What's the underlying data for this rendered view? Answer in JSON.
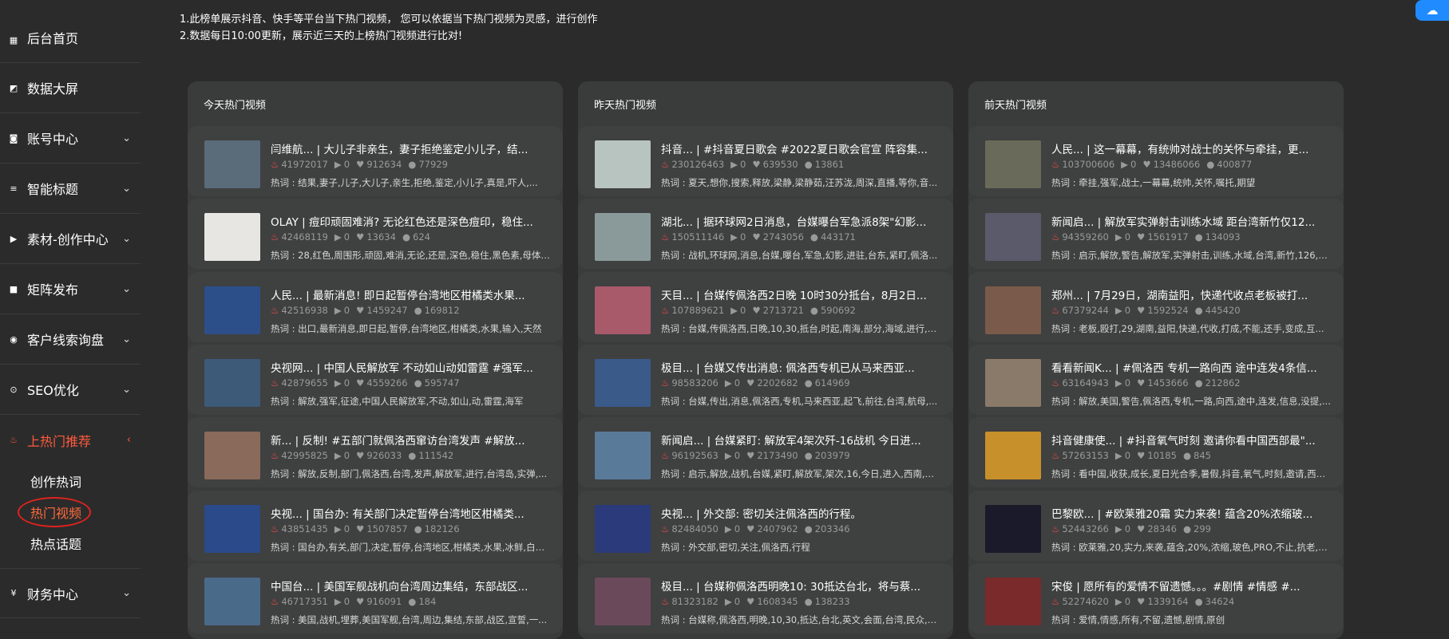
{
  "sidebar": {
    "items": [
      {
        "label": "后台首页",
        "icon": "dashboard-icon",
        "glyph": "▦",
        "chevron": ""
      },
      {
        "label": "数据大屏",
        "icon": "chart-screen-icon",
        "glyph": "◩",
        "chevron": ""
      },
      {
        "label": "账号中心",
        "icon": "account-icon",
        "glyph": "◙",
        "chevron": "⌄"
      },
      {
        "label": "智能标题",
        "icon": "title-icon",
        "glyph": "≡",
        "chevron": "⌄"
      },
      {
        "label": "素材-创作中心",
        "icon": "material-icon",
        "glyph": "▶",
        "chevron": "⌄"
      },
      {
        "label": "矩阵发布",
        "icon": "video-camera-icon",
        "glyph": "■",
        "chevron": "⌄"
      },
      {
        "label": "客户线索询盘",
        "icon": "customer-icon",
        "glyph": "◉",
        "chevron": "⌄"
      },
      {
        "label": "SEO优化",
        "icon": "seo-icon",
        "glyph": "⊙",
        "chevron": "⌄"
      },
      {
        "label": "上热门推荐",
        "icon": "fire-icon",
        "glyph": "♨",
        "chevron": "‹"
      }
    ],
    "sub_items": [
      {
        "label": "创作热词"
      },
      {
        "label": "热门视频"
      },
      {
        "label": "热点话题"
      }
    ],
    "finance": {
      "label": "财务中心",
      "icon": "finance-icon",
      "glyph": "¥",
      "chevron": "⌄"
    }
  },
  "notes": {
    "line1": "1.此榜单展示抖音、快手等平台当下热门视频， 您可以依据当下热门视频为灵感，进行创作",
    "line2": "2.数据每日10:00更新，展示近三天的上榜热门视频进行比对!"
  },
  "panels": [
    {
      "title": "今天热门视频",
      "cards": [
        {
          "title": "闫维航...   | 大儿子非亲生，妻子拒绝鉴定小儿子，结...",
          "hot": "41972017",
          "plays": "0",
          "likes": "912634",
          "comments": "77929",
          "keywords": "热词 : 结果,妻子,儿子,大儿子,亲生,拒绝,鉴定,小儿子,真是,吓人,...",
          "thumb_color": "#5a6b7a"
        },
        {
          "title": "OLAY | 痘印顽固难消? 无论红色还是深色痘印，稳住...",
          "hot": "42468119",
          "plays": "0",
          "likes": "13634",
          "comments": "624",
          "keywords": "热词 : 28,红色,周围形,顽固,难消,无论,还是,深色,稳住,黑色素,母体,...",
          "thumb_color": "#e8e6e2"
        },
        {
          "title": "人民...   | 最新消息! 即日起暂停台湾地区柑橘类水果...",
          "hot": "42516938",
          "plays": "0",
          "likes": "1459247",
          "comments": "169812",
          "keywords": "热词 : 出口,最新消息,即日起,暂停,台湾地区,柑橘类,水果,输入,天然",
          "thumb_color": "#2c4f8a"
        },
        {
          "title": "央视网...   | 中国人民解放军 不动如山动如雷霆 #强军...",
          "hot": "42879655",
          "plays": "0",
          "likes": "4559266",
          "comments": "595747",
          "keywords": "热词 : 解放,强军,征途,中国人民解放军,不动,如山,动,雷霆,海军",
          "thumb_color": "#3d5a78"
        },
        {
          "title": "新...   | 反制! #五部门就佩洛西窜访台湾发声 #解放...",
          "hot": "42995825",
          "plays": "0",
          "likes": "926033",
          "comments": "111542",
          "keywords": "热词 : 解放,反制,部门,佩洛西,台湾,发声,解放军,进行,台湾岛,实弹,...",
          "thumb_color": "#8a6a5a"
        },
        {
          "title": "央视...   | 国台办: 有关部门决定暂停台湾地区柑橘类...",
          "hot": "43851435",
          "plays": "0",
          "likes": "1507857",
          "comments": "182126",
          "keywords": "热词 : 国台办,有关,部门,决定,暂停,台湾地区,柑橘类,水果,冰鲜,白带...",
          "thumb_color": "#2a4a8a"
        },
        {
          "title": "中国台...   | 美国军舰战机向台湾周边集结，东部战区...",
          "hot": "46717351",
          "plays": "0",
          "likes": "916091",
          "comments": "184",
          "keywords": "热词 : 美国,战机,埋葬,美国军舰,台湾,周边,集结,东部,战区,宣誓,一...",
          "thumb_color": "#4a6a8a"
        }
      ]
    },
    {
      "title": "昨天热门视频",
      "cards": [
        {
          "title": "抖音...   | #抖音夏日歌会 #2022夏日歌会官宣 阵容集...",
          "hot": "230126463",
          "plays": "0",
          "likes": "639530",
          "comments": "13861",
          "keywords": "热词 : 夏天,想你,搜索,释放,梁静,梁静茹,汪苏泷,周深,直播,等你,音...",
          "thumb_color": "#b8c4c0"
        },
        {
          "title": "湖北...   | 据环球网2日消息，台媒曝台军急派8架\"幻影...",
          "hot": "150511146",
          "plays": "0",
          "likes": "2743056",
          "comments": "443171",
          "keywords": "热词 : 战机,环球网,消息,台媒,曝台,军急,幻影,进驻,台东,紧盯,佩洛...",
          "thumb_color": "#8a9a9a"
        },
        {
          "title": "天目...   | 台媒传佩洛西2日晚 10时30分抵台，8月2日...",
          "hot": "107889621",
          "plays": "0",
          "likes": "2713721",
          "comments": "590692",
          "keywords": "热词 : 台媒,传佩洛西,日晚,10,30,抵台,时起,南海,部分,海域,进行,军...",
          "thumb_color": "#a85a6a"
        },
        {
          "title": "极目...   | 台媒又传出消息: 佩洛西专机已从马来西亚...",
          "hot": "98583206",
          "plays": "0",
          "likes": "2202682",
          "comments": "614969",
          "keywords": "热词 : 台媒,传出,消息,佩洛西,专机,马来西亚,起飞,前往,台湾,航母,...",
          "thumb_color": "#3a5a8a"
        },
        {
          "title": "新闻启...   | 台媒紧盯: 解放军4架次歼-16战机 今日进...",
          "hot": "96192563",
          "plays": "0",
          "likes": "2173490",
          "comments": "203979",
          "keywords": "热词 : 启示,解放,战机,台媒,紧盯,解放军,架次,16,今日,进入,西南,空...",
          "thumb_color": "#5a7a9a"
        },
        {
          "title": "央视...   | 外交部: 密切关注佩洛西的行程。",
          "hot": "82484050",
          "plays": "0",
          "likes": "2407962",
          "comments": "203346",
          "keywords": "热词 : 外交部,密切,关注,佩洛西,行程",
          "thumb_color": "#2a3a7a"
        },
        {
          "title": "极目...   | 台媒称佩洛西明晚10: 30抵达台北，将与蔡...",
          "hot": "81323182",
          "plays": "0",
          "likes": "1608345",
          "comments": "138233",
          "keywords": "热词 : 台媒称,佩洛西,明晚,10,30,抵达,台北,英文,会面,台湾,民众,怒...",
          "thumb_color": "#6a4a5a"
        }
      ]
    },
    {
      "title": "前天热门视频",
      "cards": [
        {
          "title": "人民...   | 这一幕幕，有统帅对战士的关怀与牵挂，更...",
          "hot": "103700606",
          "plays": "0",
          "likes": "13486066",
          "comments": "400877",
          "keywords": "热词 : 牵挂,强军,战士,一幕幕,统帅,关怀,嘱托,期望",
          "thumb_color": "#6a6a5a"
        },
        {
          "title": "新闻启...   | 解放军实弹射击训练水域 距台湾新竹仅12...",
          "hot": "94359260",
          "plays": "0",
          "likes": "1561917",
          "comments": "134093",
          "keywords": "热词 : 启示,解放,警告,解放军,实弹射击,训练,水域,台湾,新竹,126,公...",
          "thumb_color": "#5a5a6a"
        },
        {
          "title": "郑州...   | 7月29日，湖南益阳，快递代收点老板被打...",
          "hot": "67379244",
          "plays": "0",
          "likes": "1592524",
          "comments": "445420",
          "keywords": "热词 : 老板,殴打,29,湖南,益阳,快递,代收,打成,不能,还手,变成,互...",
          "thumb_color": "#7a5a4a"
        },
        {
          "title": "看看新闻K...   | #佩洛西 专机一路向西 途中连发4条信...",
          "hot": "63164943",
          "plays": "0",
          "likes": "1453666",
          "comments": "212862",
          "keywords": "热词 : 解放,美国,警告,佩洛西,专机,一路,向西,途中,连发,信息,没提,...",
          "thumb_color": "#8a7a6a"
        },
        {
          "title": "抖音健康使...   | #抖音氧气时刻 邀请你看中国西部最\"...",
          "hot": "57263153",
          "plays": "0",
          "likes": "10185",
          "comments": "845",
          "keywords": "热词 : 看中国,收获,成长,夏日光合季,暑假,抖音,氧气,时刻,邀请,西部...",
          "thumb_color": "#c8902a"
        },
        {
          "title": "巴黎欧...   | #欧莱雅20霜 实力来袭! 蕴含20%浓缩玻...",
          "hot": "52443266",
          "plays": "0",
          "likes": "28346",
          "comments": "299",
          "keywords": "热词 : 欧莱雅,20,实力,来袭,蕴含,20%,浓缩,玻色,PRO,不止,抗老,更...",
          "thumb_color": "#1a1a2a"
        },
        {
          "title": "宋俊 | 愿所有的爱情不留遗憾。。。#剧情 #情感 #...",
          "hot": "52274620",
          "plays": "0",
          "likes": "1339164",
          "comments": "34624",
          "keywords": "热词 : 爱情,情感,所有,不留,遗憾,剧情,原创",
          "thumb_color": "#7a2a2a"
        }
      ]
    }
  ],
  "corner_badge": {
    "icon": "baidu-netdisk-icon",
    "glyph": "☁"
  },
  "colors": {
    "accent": "#ff5a3c",
    "circle": "#e0221f",
    "panel": "#3a3b3b",
    "card": "#3f4040",
    "background": "#2b2b2b",
    "hot_icon": "#ff4d4d"
  }
}
